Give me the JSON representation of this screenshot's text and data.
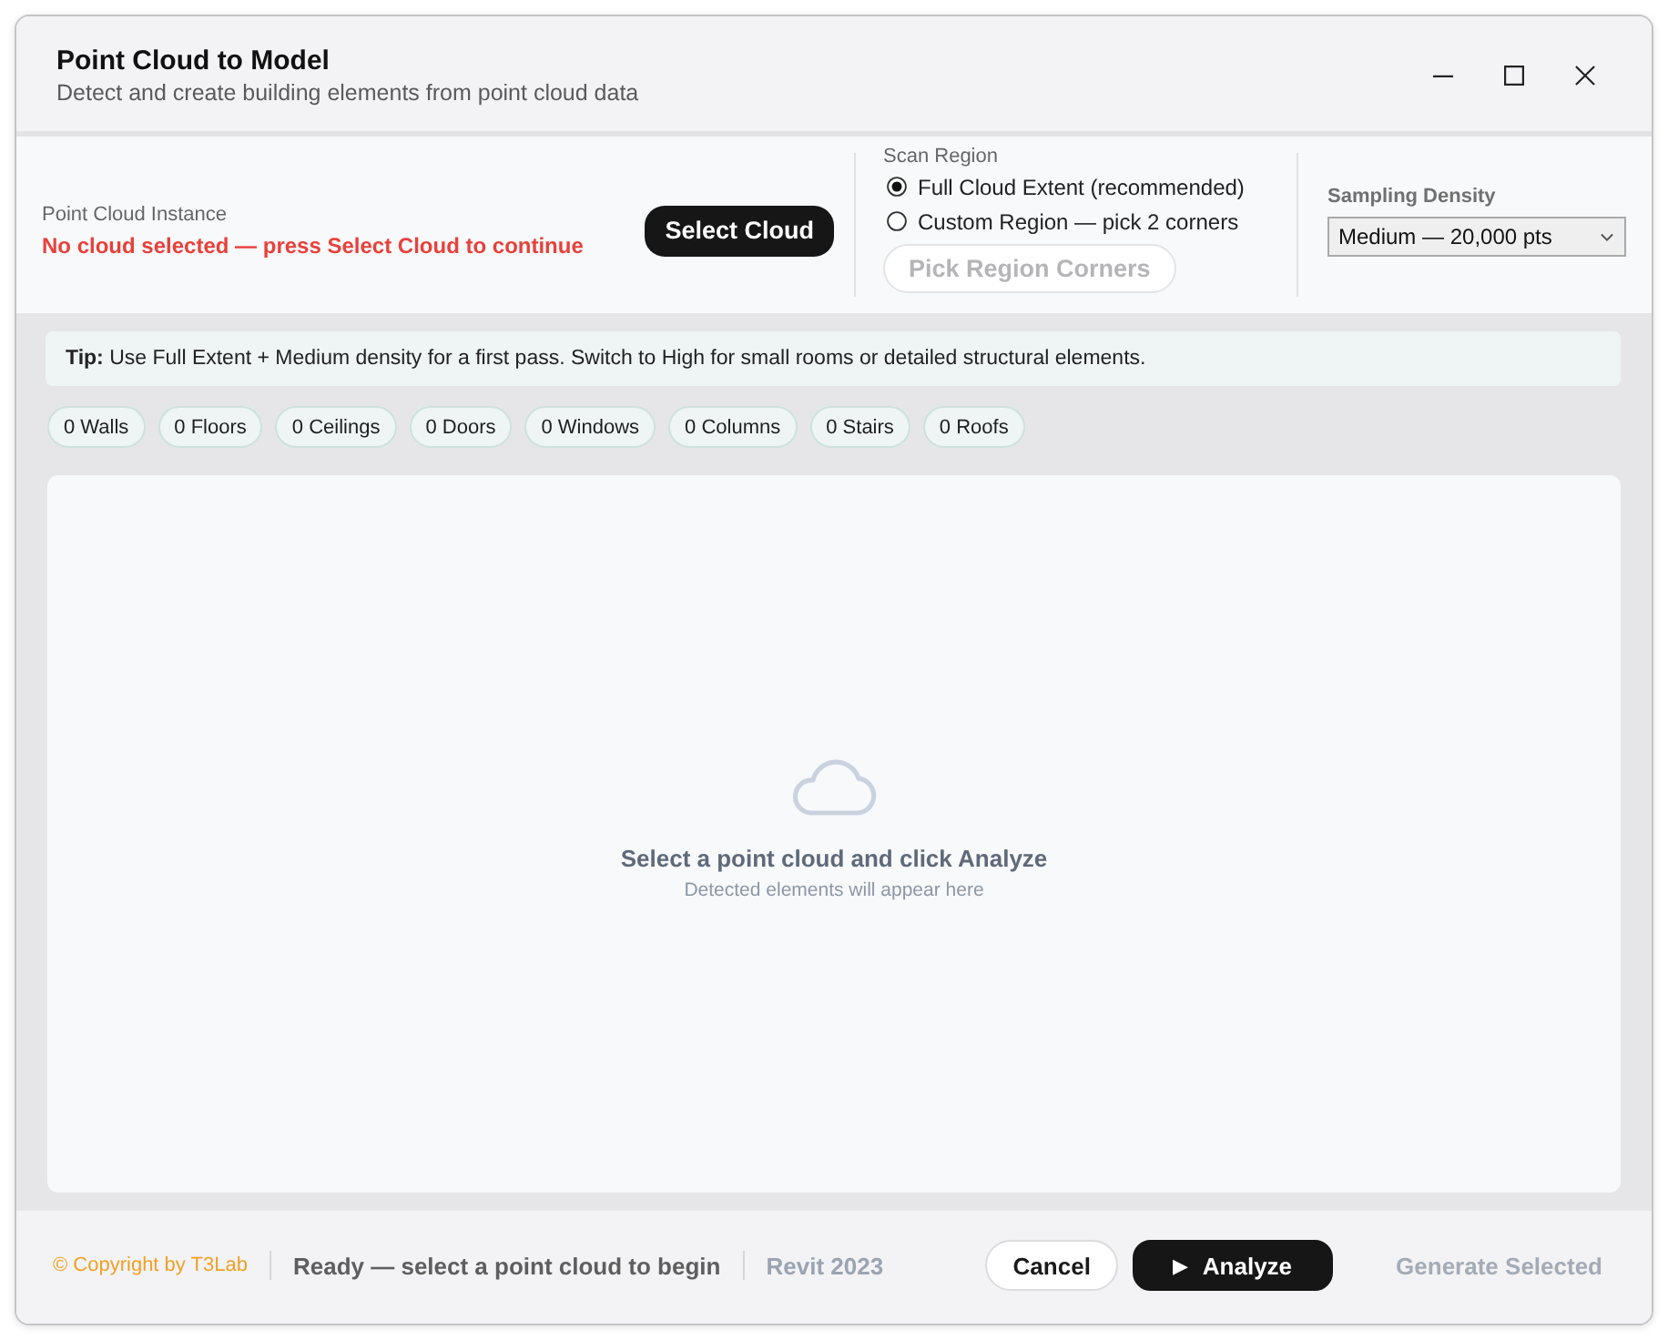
{
  "window": {
    "title": "Point Cloud to Model",
    "subtitle": "Detect and create building elements from point cloud data"
  },
  "cloud_instance": {
    "label": "Point Cloud Instance",
    "status": "No cloud selected — press Select Cloud to continue",
    "button": "Select Cloud"
  },
  "scan_region": {
    "label": "Scan Region",
    "options": [
      {
        "label": "Full Cloud Extent (recommended)",
        "selected": true
      },
      {
        "label": "Custom Region — pick 2 corners",
        "selected": false
      }
    ],
    "pick_button": {
      "label": "Pick Region Corners",
      "disabled": true
    }
  },
  "sampling_density": {
    "label": "Sampling Density",
    "value": "Medium — 20,000 pts"
  },
  "tip": "**Tip:** Use Full Extent + Medium density for a first pass. Switch to High for small rooms or detailed structural elements.",
  "element_counts": [
    "0 Walls",
    "0 Floors",
    "0 Ceilings",
    "0 Doors",
    "0 Windows",
    "0 Columns",
    "0 Stairs",
    "0 Roofs"
  ],
  "empty_state": {
    "title": "Select a point cloud and click Analyze",
    "subtitle": "Detected elements will appear here"
  },
  "footer": {
    "copyright": "© Copyright by T3Lab",
    "status": "Ready — select a point cloud to begin",
    "version": "Revit 2023",
    "buttons": [
      {
        "label": "Cancel",
        "kind": "secondary",
        "disabled": false
      },
      {
        "label": "Analyze",
        "kind": "primary",
        "glyph": "▶",
        "disabled": false
      },
      {
        "label": "Generate Selected",
        "kind": "primary",
        "disabled": true
      }
    ]
  }
}
